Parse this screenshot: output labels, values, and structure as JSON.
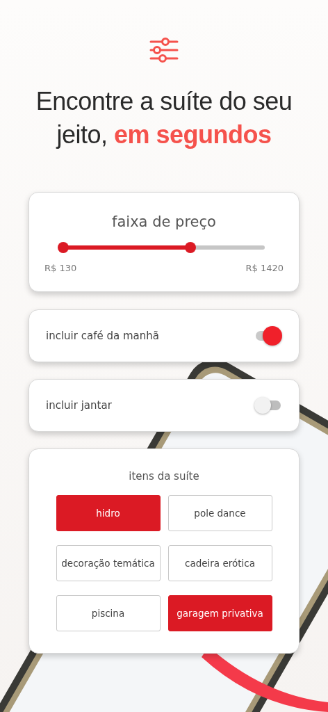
{
  "headline": {
    "lead": "Encontre a suíte do seu jeito,",
    "accent": "em segundos"
  },
  "price_range": {
    "title": "faixa de preço",
    "thumbs": [
      {
        "level": 0
      },
      {
        "level": 0.63
      }
    ],
    "min_label": "R$ 130",
    "max_label": "R$ 1420"
  },
  "toggles": [
    {
      "label": "incluir café da manhã",
      "on": true
    },
    {
      "label": "incluir jantar",
      "on": false
    }
  ],
  "amenities": {
    "title": "itens da suíte",
    "items": [
      {
        "label": "hidro",
        "selected": true
      },
      {
        "label": "pole dance",
        "selected": false
      },
      {
        "label": "decoração temática",
        "selected": false
      },
      {
        "label": "cadeira erótica",
        "selected": false
      },
      {
        "label": "piscina",
        "selected": false
      },
      {
        "label": "garagem privativa",
        "selected": true
      }
    ]
  }
}
